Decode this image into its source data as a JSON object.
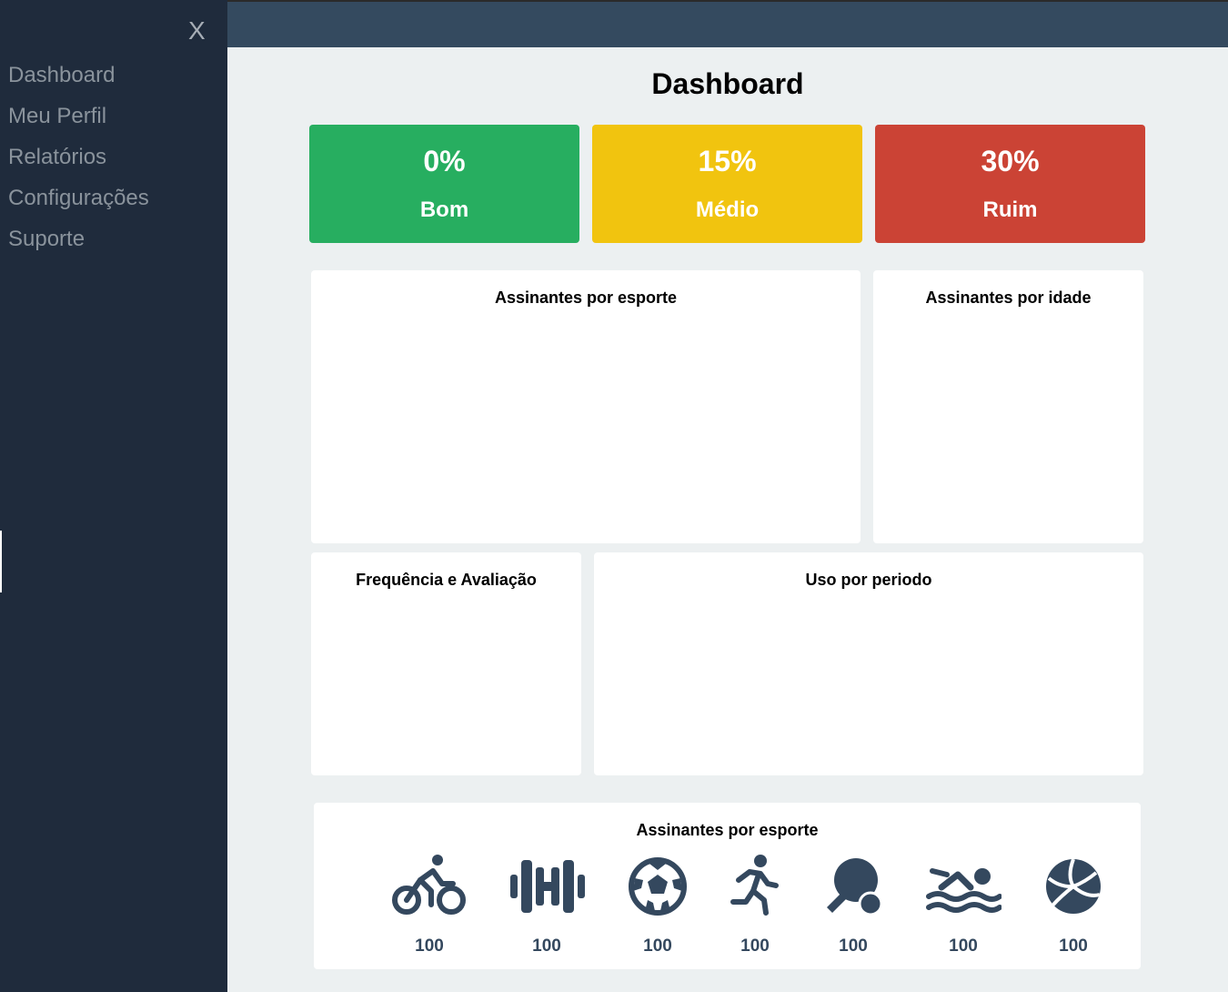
{
  "sidebar": {
    "close_label": "X",
    "items": [
      {
        "label": "Dashboard"
      },
      {
        "label": "Meu Perfil"
      },
      {
        "label": "Relatórios"
      },
      {
        "label": "Configurações"
      },
      {
        "label": "Suporte"
      }
    ]
  },
  "page": {
    "title": "Dashboard"
  },
  "stats": [
    {
      "value": "0%",
      "label": "Bom",
      "color": "#27ae60"
    },
    {
      "value": "15%",
      "label": "Médio",
      "color": "#f1c40f"
    },
    {
      "value": "30%",
      "label": "Ruim",
      "color": "#cb4335"
    }
  ],
  "cards": {
    "subscribers_by_sport": {
      "title": "Assinantes por esporte"
    },
    "subscribers_by_age": {
      "title": "Assinantes por idade"
    },
    "frequency_rating": {
      "title": "Frequência e Avaliação"
    },
    "usage_by_period": {
      "title": "Uso por periodo"
    }
  },
  "sports_panel": {
    "title": "Assinantes por esporte",
    "icon_color": "#34485e",
    "sports": [
      {
        "icon": "cycling-icon",
        "count": "100"
      },
      {
        "icon": "dumbbell-icon",
        "count": "100"
      },
      {
        "icon": "soccer-ball-icon",
        "count": "100"
      },
      {
        "icon": "running-icon",
        "count": "100"
      },
      {
        "icon": "ping-pong-icon",
        "count": "100"
      },
      {
        "icon": "swimming-icon",
        "count": "100"
      },
      {
        "icon": "volleyball-icon",
        "count": "100"
      }
    ]
  }
}
